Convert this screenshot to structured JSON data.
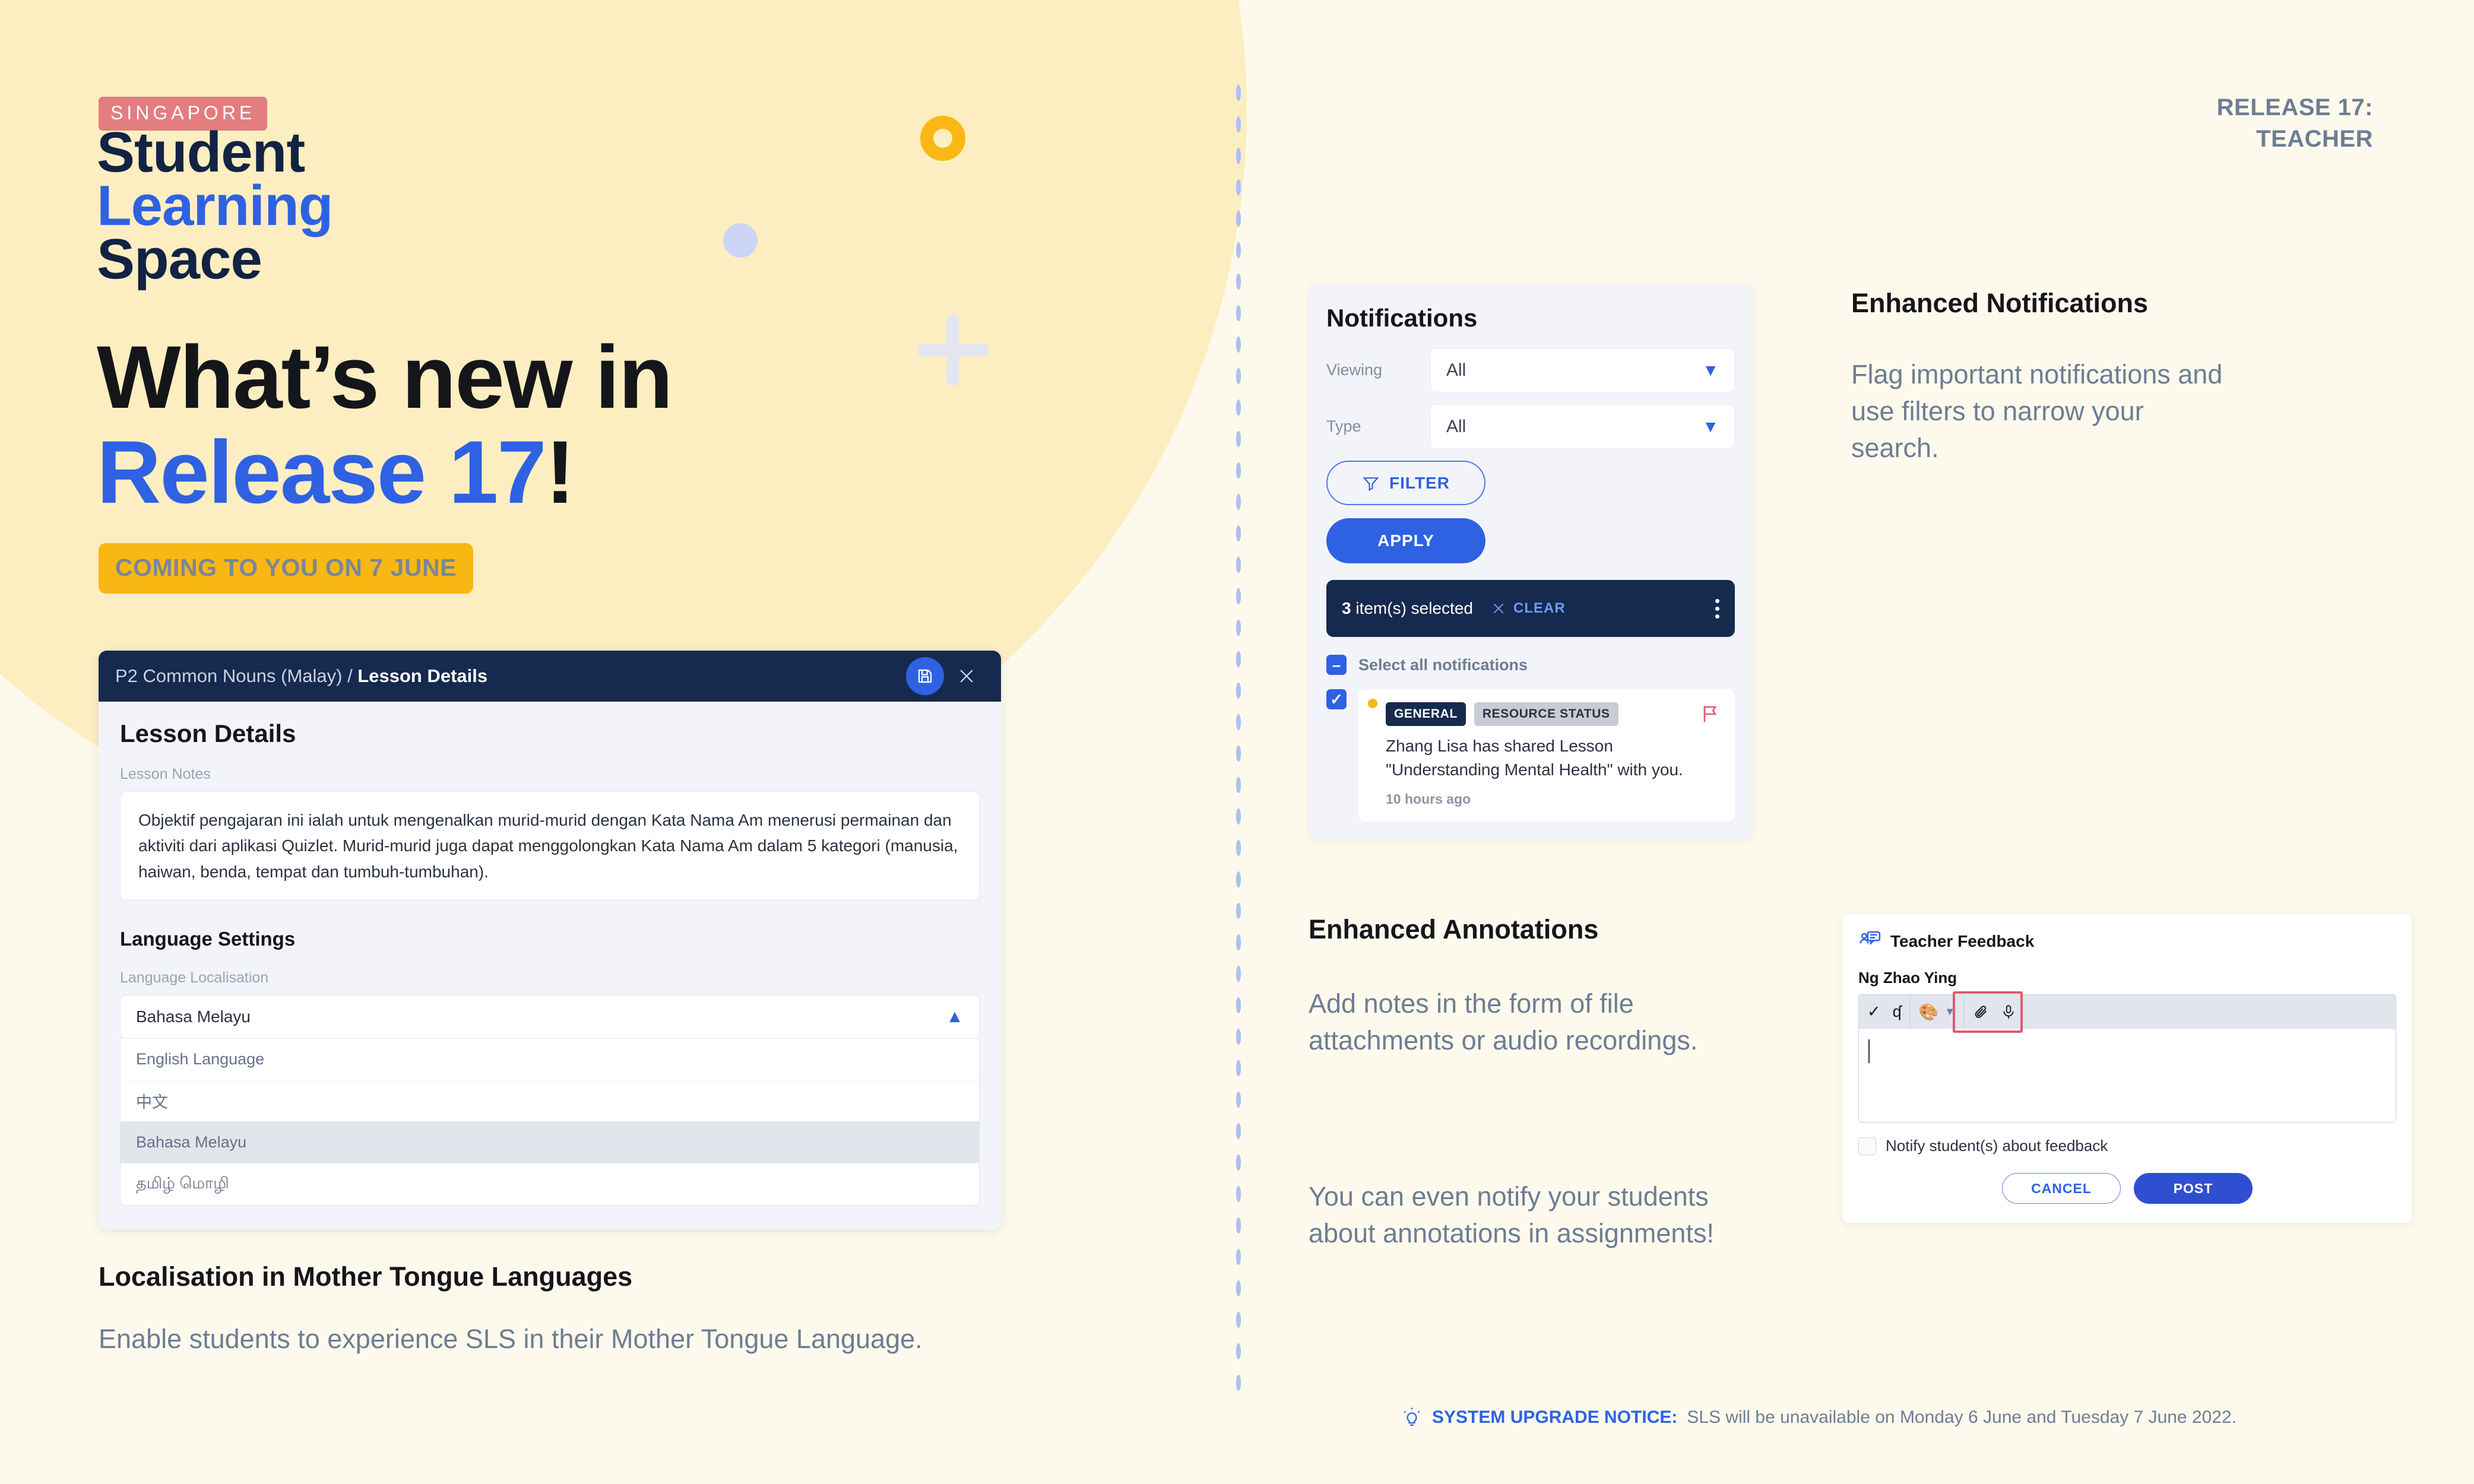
{
  "brand": {
    "badge": "SINGAPORE",
    "line1": "Student",
    "line2": "Learning",
    "line3": "Space"
  },
  "hero": {
    "headline_line1": "What’s new in",
    "headline_line2": "Release 17",
    "headline_bang": "!",
    "pill": "COMING TO YOU ON 7 JUNE"
  },
  "release_label": "RELEASE 17:\nTEACHER",
  "lesson_card": {
    "breadcrumb_parent": "P2 Common Nouns (Malay) / ",
    "breadcrumb_current": "Lesson Details",
    "save_icon": "save-icon",
    "close_icon": "close-icon",
    "title": "Lesson Details",
    "notes_label": "Lesson Notes",
    "notes_text": "Objektif pengajaran ini ialah untuk mengenalkan murid-murid dengan Kata Nama Am menerusi permainan dan aktiviti dari aplikasi Quizlet.  Murid-murid juga dapat menggolongkan Kata Nama Am dalam 5 kategori (manusia, haiwan, benda, tempat dan tumbuh-tumbuhan).",
    "section_title": "Language Settings",
    "select_label": "Language Localisation",
    "select_value": "Bahasa Melayu",
    "chevron_icon": "chevron-up-icon",
    "options": [
      {
        "label": "English Language",
        "selected": false
      },
      {
        "label": "中文",
        "selected": false
      },
      {
        "label": "Bahasa Melayu",
        "selected": true
      },
      {
        "label": "தமிழ் மொழி",
        "selected": false
      }
    ]
  },
  "feature_left": {
    "title": "Localisation in Mother Tongue Languages",
    "body": "Enable students to experience SLS in their Mother Tongue Language."
  },
  "notifications": {
    "title": "Notifications",
    "viewing_label": "Viewing",
    "viewing_value": "All",
    "type_label": "Type",
    "type_value": "All",
    "filter_button": "FILTER",
    "filter_icon": "funnel-icon",
    "apply_button": "APPLY",
    "selection_count": "3",
    "selection_text": " item(s) selected",
    "clear_label": "CLEAR",
    "clear_icon": "close-icon",
    "kebab_icon": "more-vertical-icon",
    "select_all_label": "Select all notifications",
    "select_all_state": "indeterminate",
    "items": [
      {
        "checked": true,
        "unread": true,
        "tag_primary": "GENERAL",
        "tag_secondary": "RESOURCE STATUS",
        "flag_icon": "flag-icon",
        "message": "Zhang Lisa has shared Lesson \"Understanding Mental Health\" with you.",
        "timestamp": "10 hours ago"
      }
    ]
  },
  "feature_notifications": {
    "title": "Enhanced Notifications",
    "body": "Flag important notifications and use filters to narrow your search."
  },
  "feature_annotations": {
    "title": "Enhanced Annotations",
    "body_1": "Add notes in the form of file attachments or audio recordings.",
    "body_2": "You can even notify your students about annotations in assignments!"
  },
  "teacher_feedback": {
    "header_icon": "feedback-chat-icon",
    "header_title": "Teacher Feedback",
    "student_name": "Ng Zhao Ying",
    "toolbar_icons": [
      "check-mark-icon",
      "undo-icon",
      "palette-icon",
      "chevron-down-icon",
      "paperclip-icon",
      "microphone-icon"
    ],
    "editor_value": "",
    "notify_checkbox_label": "Notify student(s) about feedback",
    "notify_checked": false,
    "cancel_button": "CANCEL",
    "post_button": "POST"
  },
  "footer": {
    "bulb_icon": "lightbulb-icon",
    "bold_part": "SYSTEM UPGRADE NOTICE:",
    "rest": " SLS will be unavailable on Monday 6 June and Tuesday 7 June 2022."
  },
  "colors": {
    "page_bg": "#fdfaed",
    "blob": "#fdeec1",
    "brand_navy": "#122344",
    "brand_blue": "#2f62e2",
    "accent_yellow": "#f8b713",
    "badge_red": "#e37d80",
    "muted_text": "#6e7d95",
    "dark_panel": "#152a4e",
    "highlight_red": "#e05a6e"
  }
}
